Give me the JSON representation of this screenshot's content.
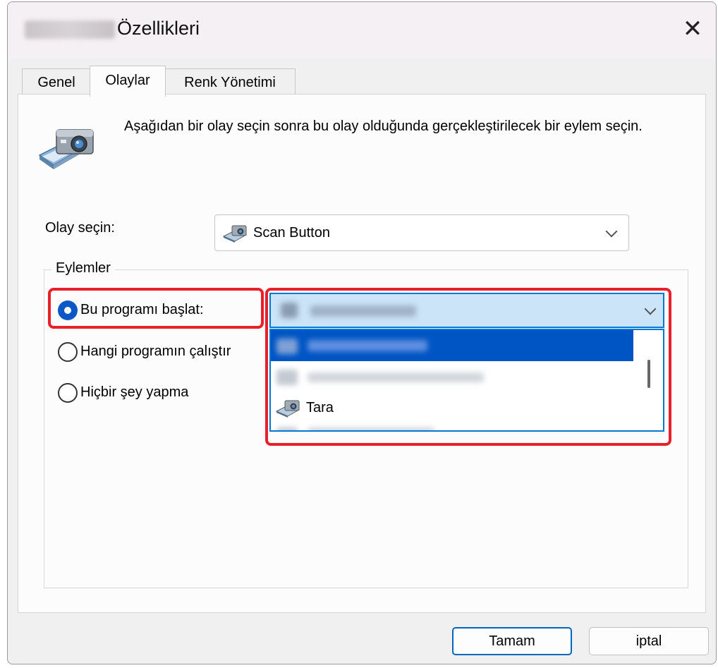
{
  "dialog": {
    "title": "Özellikleri",
    "close_glyph": "✕"
  },
  "tabs": [
    {
      "label": "Genel",
      "active": false
    },
    {
      "label": "Olaylar",
      "active": true
    },
    {
      "label": "Renk Yönetimi",
      "active": false
    }
  ],
  "events_tab": {
    "description": "Aşağıdan bir olay seçin sonra bu olay olduğunda gerçekleştirilecek bir eylem seçin.",
    "header_icon": "scanner-camera-icon",
    "event_select": {
      "label": "Olay seçin:",
      "value": "Scan Button",
      "icon": "scanner-icon"
    },
    "actions": {
      "group_title": "Eylemler",
      "options": [
        {
          "label": "Bu programı başlat:",
          "selected": true
        },
        {
          "label": "Hangi programın çalıştır",
          "selected": false
        },
        {
          "label": "Hiçbir şey yapma",
          "selected": false
        }
      ],
      "program_dropdown": {
        "items": [
          {
            "label": "",
            "blurred": true,
            "selected": true
          },
          {
            "label": "",
            "blurred": true,
            "selected": false
          },
          {
            "label": "Tara",
            "blurred": false,
            "selected": false,
            "icon": "scanner-icon"
          },
          {
            "label": "",
            "blurred": true,
            "selected": false
          }
        ]
      }
    }
  },
  "buttons": {
    "ok_label": "Tamam",
    "cancel_label": "iptal"
  },
  "colors": {
    "accent": "#0078d4",
    "selected_radio": "#0a58c7",
    "list_selection": "#0055c4",
    "highlight_frame": "#e8202a"
  }
}
